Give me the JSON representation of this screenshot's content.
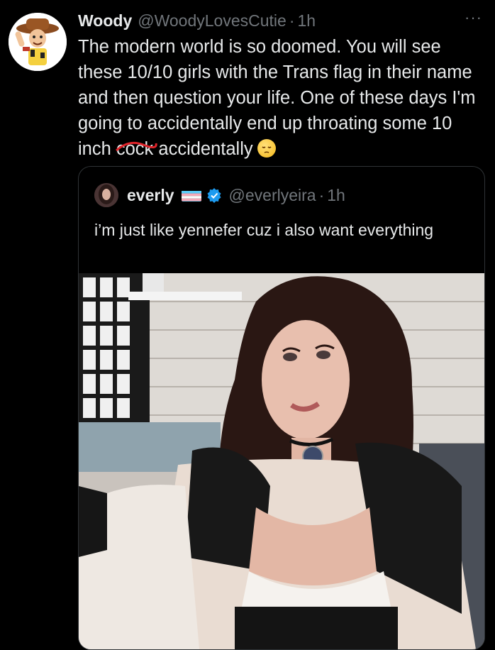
{
  "tweet": {
    "author_name": "Woody",
    "author_handle": "@WoodyLovesCutie",
    "separator": "·",
    "time": "1h",
    "more": "···",
    "text_before": "The modern world is so doomed. You will see these 10/10 girls with the Trans flag in their name and then question your life. One of these days I'm going to accidentally end up throating some 10 inch ",
    "struck_word": "cock",
    "text_after": " accidentally"
  },
  "quoted": {
    "author_name": "everly",
    "author_handle": "@everlyeira",
    "separator": "·",
    "time": "1h",
    "text": "i’m just like yennefer cuz i also want everything"
  },
  "colors": {
    "background": "#000000",
    "text": "#e7e9ea",
    "muted": "#71767b",
    "verified": "#1d9bf0",
    "strike": "#e0242a"
  },
  "icons": {
    "more": "more-dots-icon",
    "verified": "verified-badge-icon",
    "flag": "trans-flag-icon",
    "emoji": "pensive-face-icon"
  }
}
